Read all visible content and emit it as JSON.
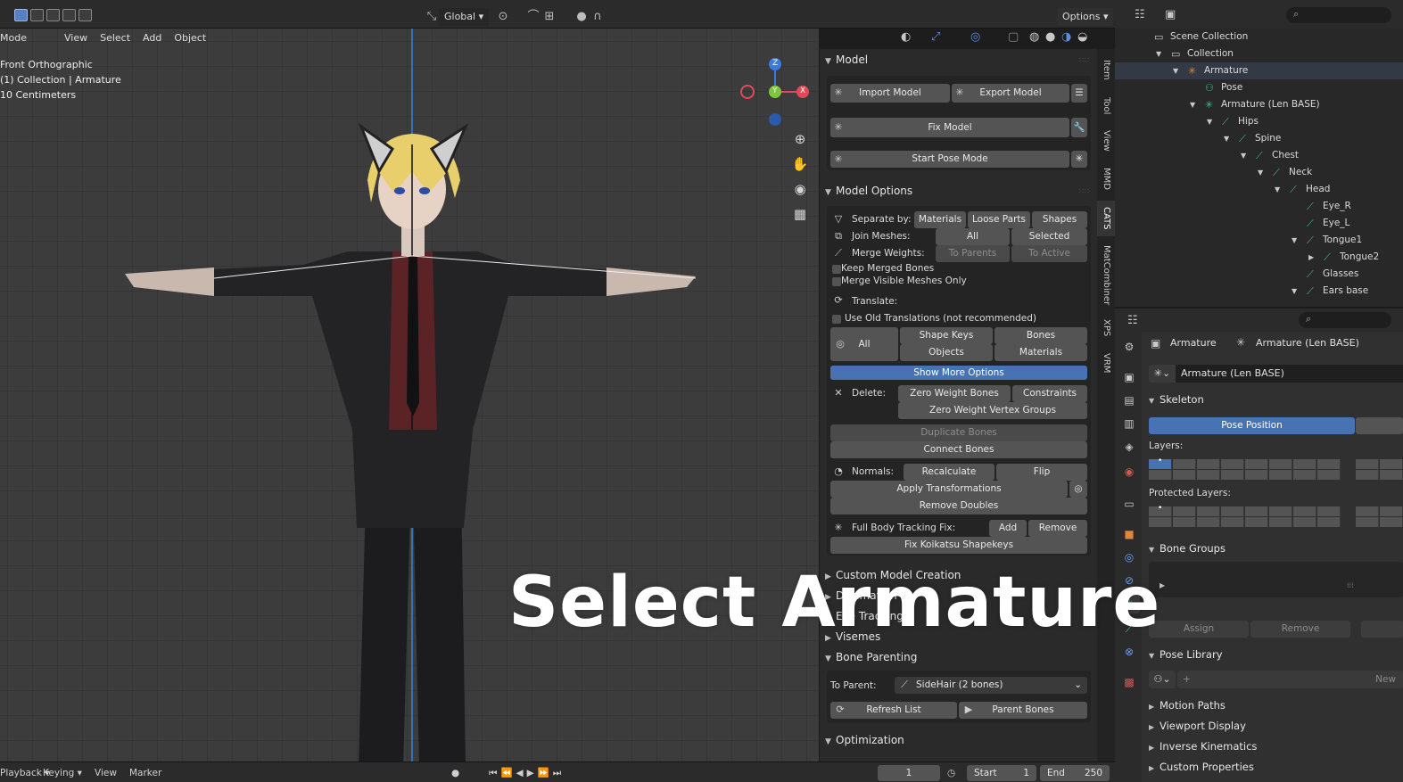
{
  "topbar": {
    "global_label": "Global",
    "options_label": "Options"
  },
  "viewport": {
    "menu": [
      "Mode",
      "View",
      "Select",
      "Add",
      "Object"
    ],
    "info": [
      "Front Orthographic",
      "(1) Collection | Armature",
      "10 Centimeters"
    ],
    "overlay_title": "Select Armature",
    "gizmo_axes": {
      "x": "X",
      "y": "Y",
      "z": "Z"
    }
  },
  "cats": {
    "tabs": [
      "Item",
      "Tool",
      "View",
      "MMD",
      "CATS",
      "MatCombiner",
      "XPS",
      "VRM"
    ],
    "model": {
      "title": "Model",
      "import": "Import Model",
      "export": "Export Model",
      "fix": "Fix Model",
      "pose": "Start Pose Mode"
    },
    "options": {
      "title": "Model Options",
      "separate_by": "Separate by:",
      "separate_btns": [
        "Materials",
        "Loose Parts",
        "Shapes"
      ],
      "join_meshes": "Join Meshes:",
      "join_btns": [
        "All",
        "Selected"
      ],
      "merge_weights": "Merge Weights:",
      "merge_btns": [
        "To Parents",
        "To Active"
      ],
      "keep_merged": "Keep Merged Bones",
      "merge_visible": "Merge Visible Meshes Only",
      "translate": "Translate:",
      "use_old": "Use Old Translations (not recommended)",
      "all": "All",
      "translate_btns": [
        "Shape Keys",
        "Bones",
        "Objects",
        "Materials"
      ],
      "show_more": "Show More Options",
      "delete": "Delete:",
      "delete_btns": [
        "Zero Weight Bones",
        "Constraints",
        "Zero Weight Vertex Groups"
      ],
      "duplicate": "Duplicate Bones",
      "connect": "Connect Bones",
      "normals": "Normals:",
      "normals_btns": [
        "Recalculate",
        "Flip"
      ],
      "apply_transforms": "Apply Transformations",
      "remove_doubles": "Remove Doubles",
      "fbt": "Full Body Tracking Fix:",
      "fbt_btns": [
        "Add",
        "Remove"
      ],
      "fix_koikatsu": "Fix Koikatsu Shapekeys"
    },
    "collapsed": [
      "Custom Model Creation",
      "Decimation",
      "Eye Tracking",
      "Visemes"
    ],
    "bone_parenting": {
      "title": "Bone Parenting",
      "to_parent": "To Parent:",
      "value": "SideHair (2 bones)",
      "refresh": "Refresh List",
      "parent_bones": "Parent Bones"
    },
    "optimization": "Optimization"
  },
  "outliner": {
    "rows": [
      {
        "label": "Scene Collection",
        "depth": 0,
        "arrow": "",
        "icon": "collection-icon"
      },
      {
        "label": "Collection",
        "depth": 1,
        "arrow": "▼",
        "icon": "collection-icon"
      },
      {
        "label": "Armature",
        "depth": 2,
        "arrow": "▼",
        "icon": "armature-icon"
      },
      {
        "label": "Pose",
        "depth": 3,
        "arrow": "",
        "icon": "pose-icon"
      },
      {
        "label": "Armature (Len BASE)",
        "depth": 3,
        "arrow": "▼",
        "icon": "armature-data-icon"
      },
      {
        "label": "Hips",
        "depth": 4,
        "arrow": "▼",
        "icon": "bone-icon"
      },
      {
        "label": "Spine",
        "depth": 5,
        "arrow": "▼",
        "icon": "bone-icon"
      },
      {
        "label": "Chest",
        "depth": 6,
        "arrow": "▼",
        "icon": "bone-icon"
      },
      {
        "label": "Neck",
        "depth": 7,
        "arrow": "▼",
        "icon": "bone-icon"
      },
      {
        "label": "Head",
        "depth": 8,
        "arrow": "▼",
        "icon": "bone-icon"
      },
      {
        "label": "Eye_R",
        "depth": 9,
        "arrow": "",
        "icon": "bone-icon"
      },
      {
        "label": "Eye_L",
        "depth": 9,
        "arrow": "",
        "icon": "bone-icon"
      },
      {
        "label": "Tongue1",
        "depth": 9,
        "arrow": "▼",
        "icon": "bone-icon"
      },
      {
        "label": "Tongue2",
        "depth": 10,
        "arrow": "▶",
        "icon": "bone-icon"
      },
      {
        "label": "Glasses",
        "depth": 9,
        "arrow": "",
        "icon": "bone-icon"
      },
      {
        "label": "Ears base",
        "depth": 9,
        "arrow": "▼",
        "icon": "bone-icon"
      }
    ]
  },
  "properties": {
    "breadcrumb": [
      "Armature",
      "Armature (Len BASE)"
    ],
    "data_name": "Armature (Len BASE)",
    "skeleton": "Skeleton",
    "pose_position": "Pose Position",
    "layers": "Layers:",
    "protected_layers": "Protected Layers:",
    "bone_groups": "Bone Groups",
    "assign": "Assign",
    "remove": "Remove",
    "pose_library": "Pose Library",
    "new": "New",
    "collapsed": [
      "Motion Paths",
      "Viewport Display",
      "Inverse Kinematics",
      "Custom Properties"
    ]
  },
  "timeline": {
    "items": [
      "Playback",
      "Keying",
      "View",
      "Marker"
    ],
    "current_frame": "1",
    "start_label": "Start",
    "start": "1",
    "end_label": "End",
    "end": "250"
  },
  "colors": {
    "accent": "#4772b3",
    "bone": "#31c39a",
    "armature": "#e0863a"
  }
}
